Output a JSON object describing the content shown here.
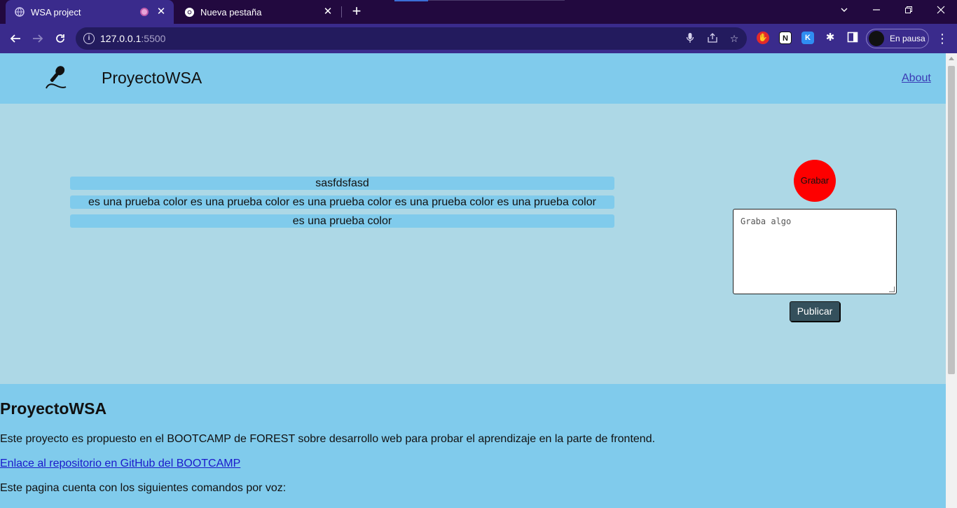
{
  "browser": {
    "tabs": [
      {
        "title": "WSA project",
        "active": true,
        "recording": true
      },
      {
        "title": "Nueva pestaña",
        "active": false,
        "recording": false
      }
    ],
    "url_host": "127.0.0.1",
    "url_port": ":5500",
    "profile_label": "En pausa",
    "accent_color": "#3a2b8c"
  },
  "site": {
    "title": "ProyectoWSA",
    "nav_about": "About"
  },
  "messages": [
    "sasfdsfasd",
    "es una prueba color es una prueba color es una prueba color es una prueba color es una prueba color",
    "es una prueba color"
  ],
  "recorder": {
    "record_label": "Grabar",
    "record_color": "#fe0000",
    "textarea_placeholder": "Graba algo",
    "publish_label": "Publicar"
  },
  "footer": {
    "heading": "ProyectoWSA",
    "description": "Este proyecto es propuesto en el BOOTCAMP de FOREST sobre desarrollo web para probar el aprendizaje en la parte de frontend.",
    "repo_link": "Enlace al repositorio en GitHub del BOOTCAMP",
    "commands_intro": "Este pagina cuenta con los siguientes comandos por voz:"
  }
}
